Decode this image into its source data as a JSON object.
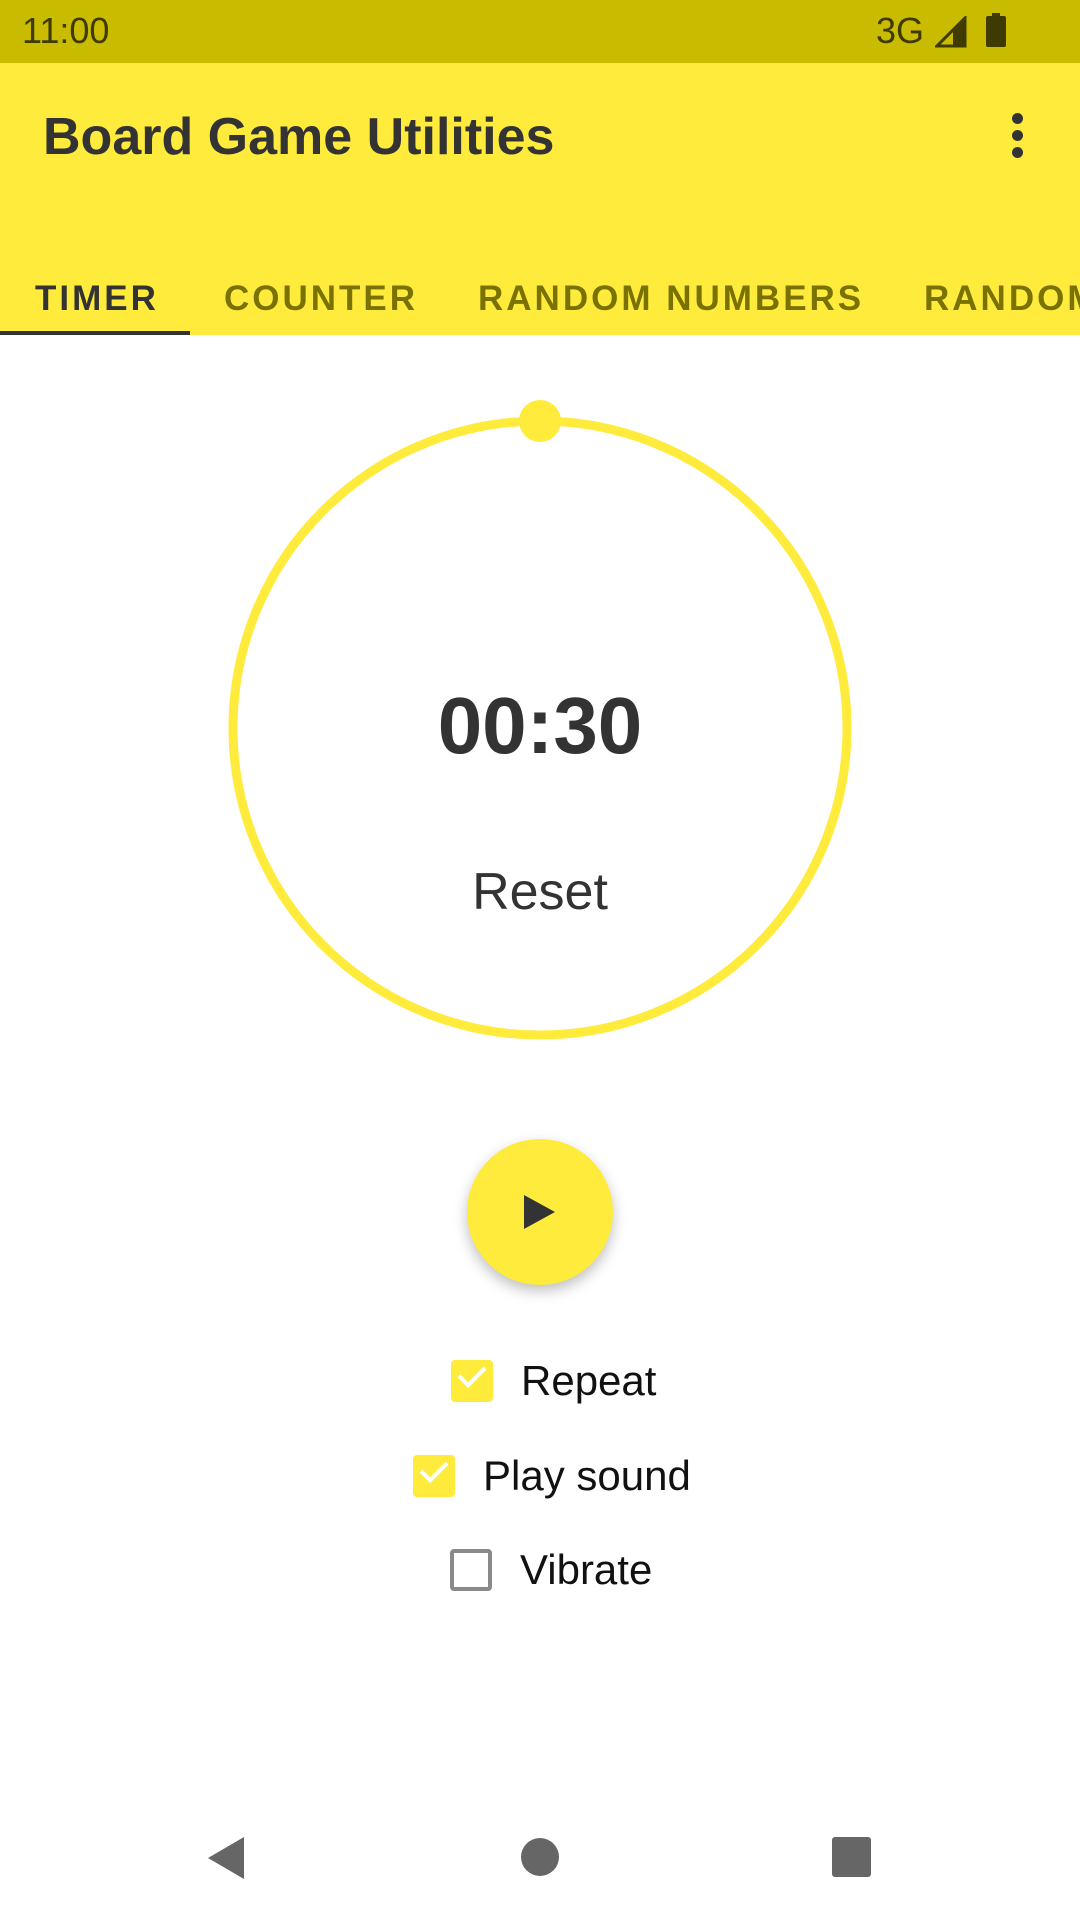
{
  "status_bar": {
    "time": "11:00",
    "network": "3G",
    "icons": [
      "signal-icon",
      "battery-icon"
    ]
  },
  "app_bar": {
    "title": "Board Game Utilities",
    "overflow_icon": "more-vert-icon"
  },
  "tabs": [
    {
      "label": "TIMER",
      "active": true
    },
    {
      "label": "COUNTER",
      "active": false
    },
    {
      "label": "RANDOM NUMBERS",
      "active": false
    },
    {
      "label": "RANDOM",
      "active": false
    }
  ],
  "timer": {
    "display": "00:30",
    "reset_label": "Reset",
    "dial_progress": 0.0,
    "play_icon": "play-icon"
  },
  "options": [
    {
      "label": "Repeat",
      "checked": true
    },
    {
      "label": "Play sound",
      "checked": true
    },
    {
      "label": "Vibrate",
      "checked": false
    }
  ],
  "colors": {
    "accent": "#ffeb3b",
    "status_bar": "#c9bc00",
    "text": "#333333"
  },
  "nav_bar": [
    "back-icon",
    "home-icon",
    "recents-icon"
  ]
}
